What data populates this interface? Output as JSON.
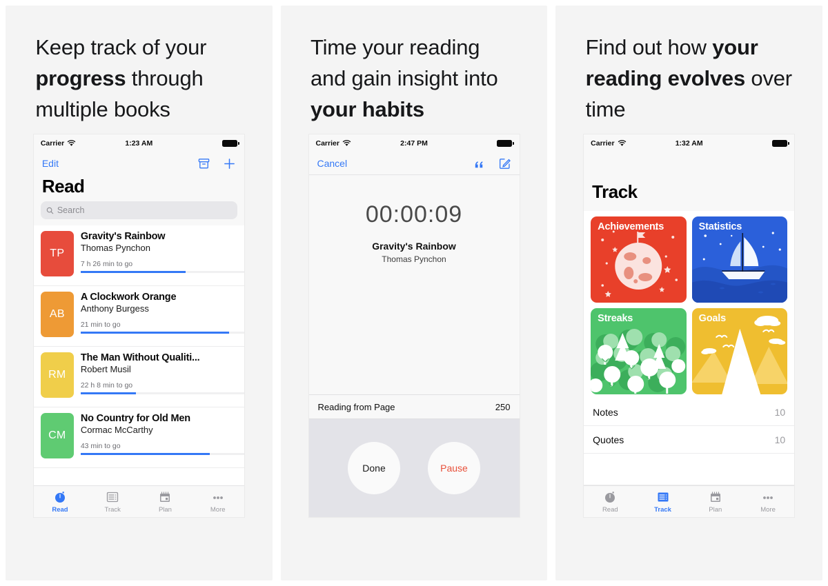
{
  "panels": [
    {
      "headline": {
        "pre": "Keep track of your ",
        "bold": "progress",
        "post": " through multiple books"
      },
      "status": {
        "carrier": "Carrier",
        "time": "1:23 AM"
      },
      "nav": {
        "left": "Edit",
        "icons": [
          "archive-box-icon",
          "plus-icon"
        ]
      },
      "title": "Read",
      "search_placeholder": "Search",
      "books": [
        {
          "initials": "TP",
          "color": "#e74c3c",
          "title": "Gravity's Rainbow",
          "author": "Thomas Pynchon",
          "togo": "7 h 26 min to go",
          "progress": 64
        },
        {
          "initials": "AB",
          "color": "#ee9a35",
          "title": "A Clockwork Orange",
          "author": "Anthony Burgess",
          "togo": "21 min to go",
          "progress": 91
        },
        {
          "initials": "RM",
          "color": "#f0ce4a",
          "title": "The Man Without Qualiti...",
          "author": "Robert Musil",
          "togo": "22 h 8 min to go",
          "progress": 34
        },
        {
          "initials": "CM",
          "color": "#5fcb72",
          "title": "No Country for Old Men",
          "author": "Cormac McCarthy",
          "togo": "43 min to go",
          "progress": 79
        }
      ],
      "tabs": [
        {
          "label": "Read",
          "icon": "timer-icon",
          "active": true
        },
        {
          "label": "Track",
          "icon": "list-icon",
          "active": false
        },
        {
          "label": "Plan",
          "icon": "calendar-icon",
          "active": false
        },
        {
          "label": "More",
          "icon": "ellipsis-icon",
          "active": false
        }
      ]
    },
    {
      "headline": {
        "pre": "Time your reading and gain insight into ",
        "bold": "your habits",
        "post": ""
      },
      "status": {
        "carrier": "Carrier",
        "time": "2:47 PM"
      },
      "nav": {
        "left": "Cancel",
        "icons": [
          "quotes-icon",
          "compose-icon"
        ]
      },
      "timer": "00:00:09",
      "timer_book": "Gravity's Rainbow",
      "timer_author": "Thomas Pynchon",
      "page_label": "Reading from Page",
      "page_value": "250",
      "buttons": {
        "done": "Done",
        "pause": "Pause"
      }
    },
    {
      "headline": {
        "pre": "Find out how ",
        "bold": "your reading evolves",
        "post": " over time"
      },
      "status": {
        "carrier": "Carrier",
        "time": "1:32 AM"
      },
      "title": "Track",
      "cards": [
        {
          "label": "Achievements",
          "color": "#e8402a",
          "art": "planet-flag-art"
        },
        {
          "label": "Statistics",
          "color": "#2b60da",
          "art": "sailboat-art"
        },
        {
          "label": "Streaks",
          "color": "#4ec46c",
          "art": "forest-art"
        },
        {
          "label": "Goals",
          "color": "#efbe30",
          "art": "mountain-art"
        }
      ],
      "rows": [
        {
          "label": "Notes",
          "value": "10"
        },
        {
          "label": "Quotes",
          "value": "10"
        }
      ],
      "tabs": [
        {
          "label": "Read",
          "icon": "timer-icon",
          "active": false
        },
        {
          "label": "Track",
          "icon": "list-icon",
          "active": true
        },
        {
          "label": "Plan",
          "icon": "calendar-icon",
          "active": false
        },
        {
          "label": "More",
          "icon": "ellipsis-icon",
          "active": false
        }
      ]
    }
  ],
  "colors": {
    "accent": "#3478f6",
    "danger": "#e8503a",
    "muted": "#9a9a9f"
  }
}
